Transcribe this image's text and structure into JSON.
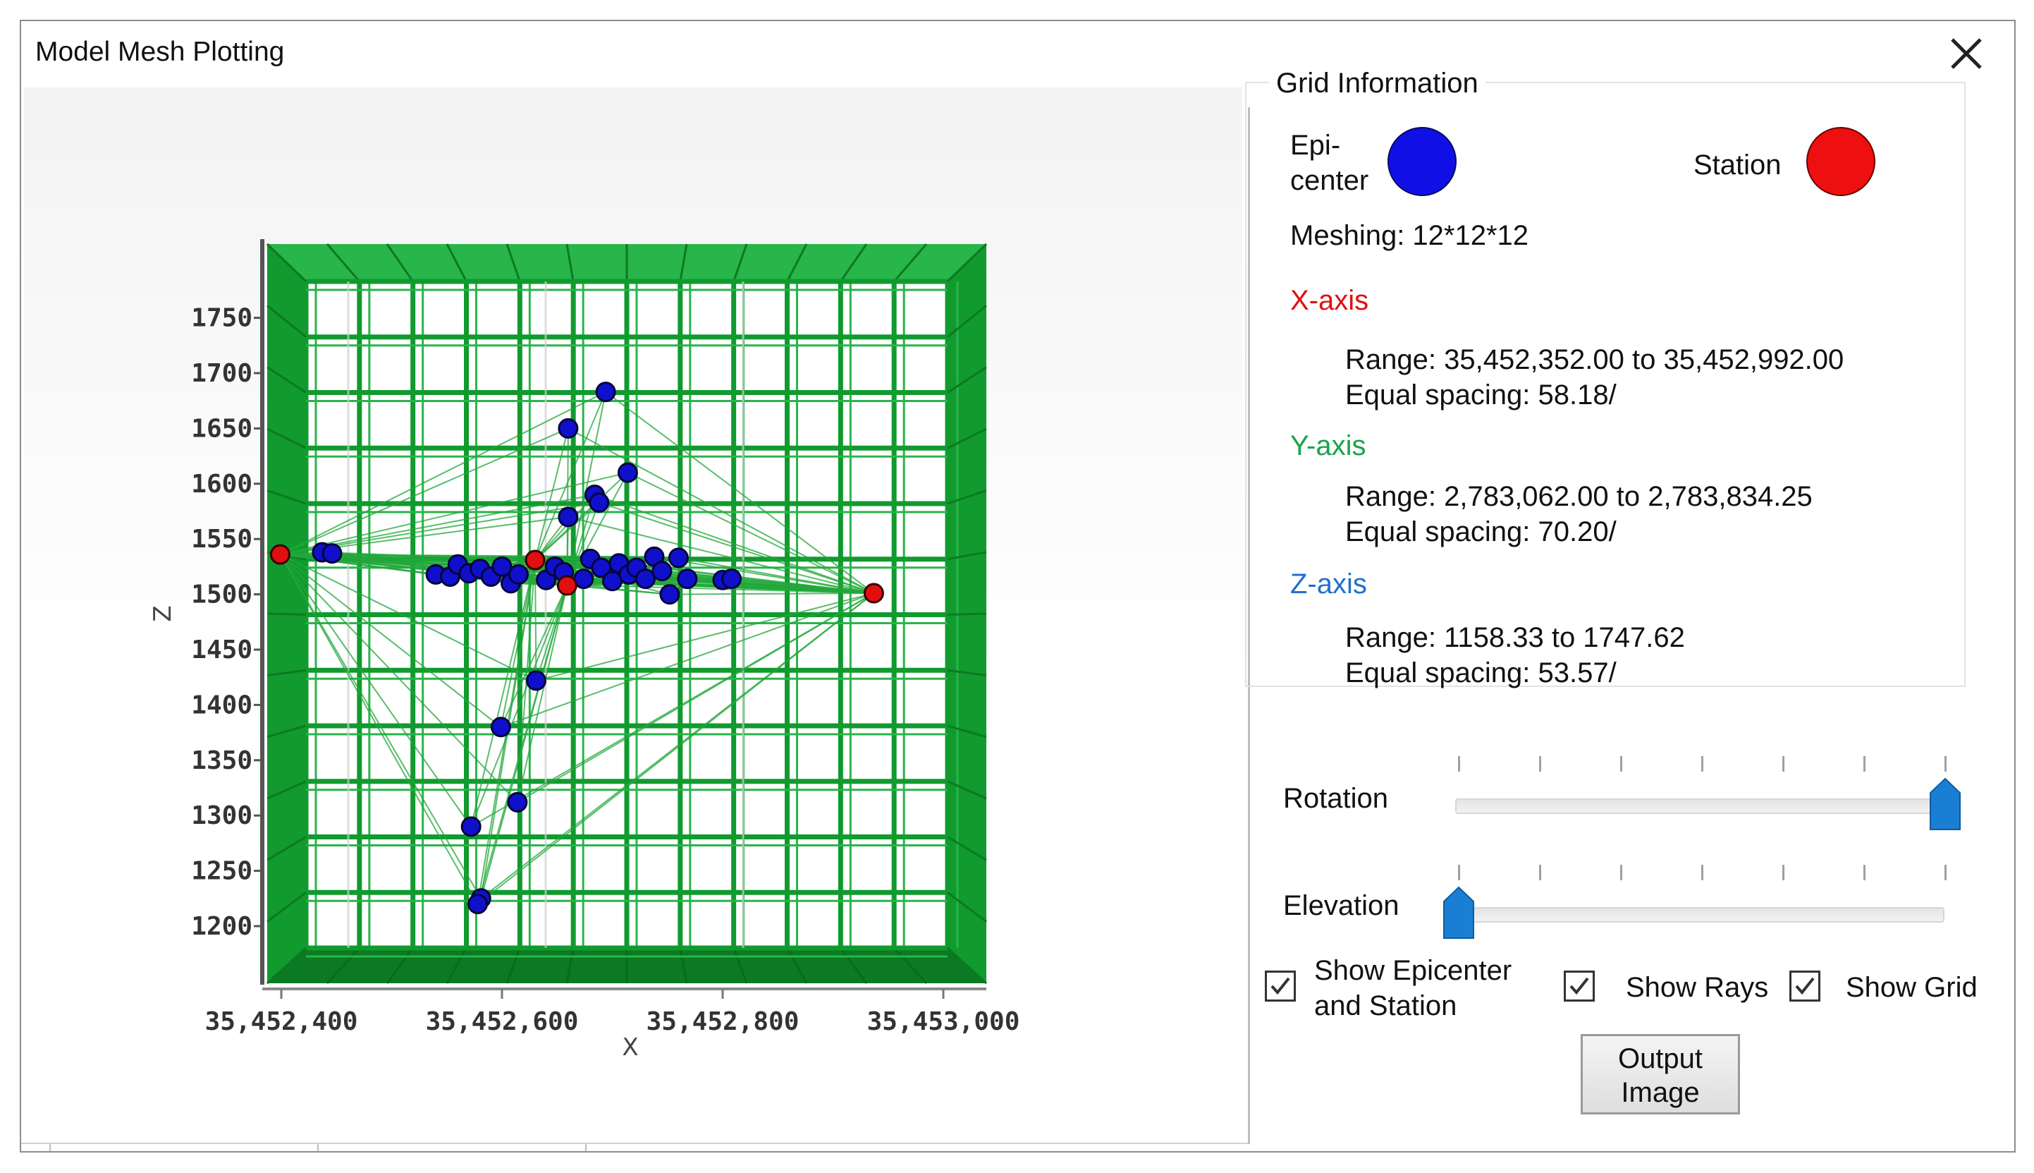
{
  "window": {
    "title": "Model Mesh Plotting"
  },
  "icons": {
    "close": "close-icon",
    "check": "checkmark-icon",
    "thumb": "slider-thumb-icon"
  },
  "colors": {
    "mesh": "#119a2e",
    "mesh_dark": "#0b7a22",
    "mesh_light": "#28b54a",
    "ray": "#22a83a",
    "epicenter": "#1010cc",
    "station": "#e01010",
    "x_axis_label": "#e01010",
    "y_axis_label": "#19a34a",
    "z_axis_label": "#1f6fd0",
    "thumb": "#1a7fd4"
  },
  "chart_data": {
    "type": "scatter",
    "xlabel": "X",
    "ylabel": "Z",
    "xlim": [
      35452352,
      35452992
    ],
    "ylim": [
      1158.33,
      1747.62
    ],
    "x_ticks": [
      35452400,
      35452600,
      35452800,
      35453000
    ],
    "x_tick_labels": [
      "35,452,400",
      "35,452,600",
      "35,452,800",
      "35,453,000"
    ],
    "y_ticks": [
      1200,
      1250,
      1300,
      1350,
      1400,
      1450,
      1500,
      1550,
      1600,
      1650,
      1700,
      1750
    ],
    "y_tick_labels": [
      "1200",
      "1250",
      "1300",
      "1350",
      "1400",
      "1450",
      "1500",
      "1550",
      "1600",
      "1650",
      "1700",
      "1750"
    ],
    "grid": true,
    "mesh_divisions": [
      12,
      12,
      12
    ],
    "stations": [
      {
        "x": 35452399,
        "z": 1536
      },
      {
        "x": 35452937,
        "z": 1501
      },
      {
        "x": 35452630,
        "z": 1531
      },
      {
        "x": 35452659,
        "z": 1508
      }
    ],
    "epicenters": [
      {
        "x": 35452694,
        "z": 1683
      },
      {
        "x": 35452660,
        "z": 1650
      },
      {
        "x": 35452714,
        "z": 1610
      },
      {
        "x": 35452684,
        "z": 1590
      },
      {
        "x": 35452688,
        "z": 1583
      },
      {
        "x": 35452660,
        "z": 1570
      },
      {
        "x": 35452437,
        "z": 1538
      },
      {
        "x": 35452446,
        "z": 1537
      },
      {
        "x": 35452540,
        "z": 1518
      },
      {
        "x": 35452553,
        "z": 1516
      },
      {
        "x": 35452560,
        "z": 1527
      },
      {
        "x": 35452570,
        "z": 1519
      },
      {
        "x": 35452580,
        "z": 1523
      },
      {
        "x": 35452590,
        "z": 1516
      },
      {
        "x": 35452600,
        "z": 1525
      },
      {
        "x": 35452608,
        "z": 1510
      },
      {
        "x": 35452615,
        "z": 1518
      },
      {
        "x": 35452640,
        "z": 1513
      },
      {
        "x": 35452648,
        "z": 1525
      },
      {
        "x": 35452656,
        "z": 1520
      },
      {
        "x": 35452674,
        "z": 1514
      },
      {
        "x": 35452680,
        "z": 1532
      },
      {
        "x": 35452690,
        "z": 1524
      },
      {
        "x": 35452700,
        "z": 1512
      },
      {
        "x": 35452706,
        "z": 1528
      },
      {
        "x": 35452715,
        "z": 1518
      },
      {
        "x": 35452722,
        "z": 1524
      },
      {
        "x": 35452730,
        "z": 1514
      },
      {
        "x": 35452738,
        "z": 1534
      },
      {
        "x": 35452745,
        "z": 1521
      },
      {
        "x": 35452752,
        "z": 1500
      },
      {
        "x": 35452760,
        "z": 1533
      },
      {
        "x": 35452768,
        "z": 1514
      },
      {
        "x": 35452800,
        "z": 1513
      },
      {
        "x": 35452808,
        "z": 1514
      },
      {
        "x": 35452631,
        "z": 1422
      },
      {
        "x": 35452599,
        "z": 1380
      },
      {
        "x": 35452614,
        "z": 1312
      },
      {
        "x": 35452572,
        "z": 1290
      },
      {
        "x": 35452581,
        "z": 1225
      },
      {
        "x": 35452578,
        "z": 1220
      }
    ]
  },
  "panel": {
    "group_title": "Grid Information",
    "epicenter_label_1": "Epi-",
    "epicenter_label_2": "center",
    "station_label": "Station",
    "meshing": "Meshing: 12*12*12",
    "x_axis": {
      "title": "X-axis",
      "range": "Range: 35,452,352.00 to 35,452,992.00",
      "spacing": "Equal spacing: 58.18/"
    },
    "y_axis": {
      "title": "Y-axis",
      "range": "Range: 2,783,062.00 to 2,783,834.25",
      "spacing": "Equal spacing: 70.20/"
    },
    "z_axis": {
      "title": "Z-axis",
      "range": "Range: 1158.33 to 1747.62",
      "spacing": "Equal spacing: 53.57/"
    }
  },
  "controls": {
    "rotation_label": "Rotation",
    "rotation_value": 1.0,
    "elevation_label": "Elevation",
    "elevation_value": 0.0,
    "slider_ticks": 7,
    "show_epicenter_line1": "Show Epicenter",
    "show_epicenter_line2": "and Station",
    "show_epicenter_checked": true,
    "show_rays": "Show Rays",
    "show_rays_checked": true,
    "show_grid": "Show Grid",
    "show_grid_checked": true,
    "output_line1": "Output",
    "output_line2": "Image"
  }
}
